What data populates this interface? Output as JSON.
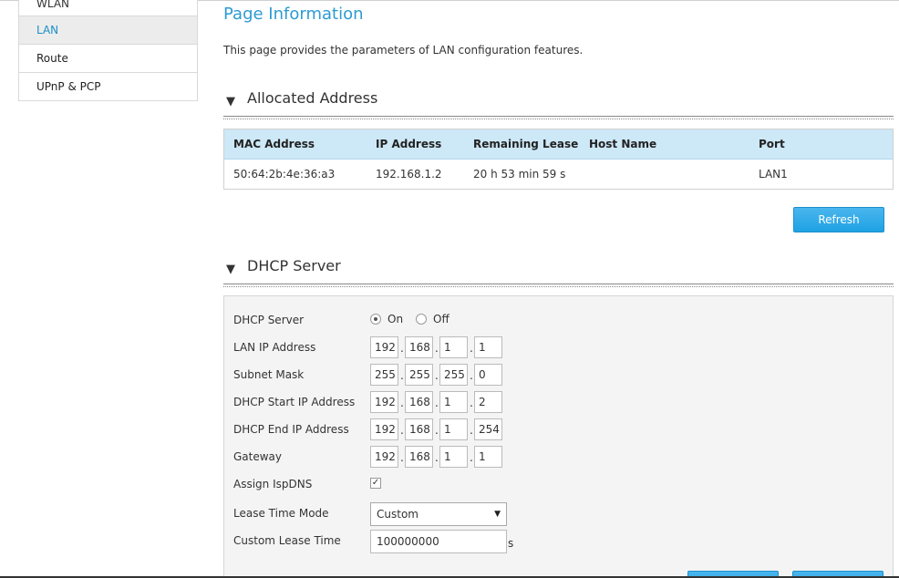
{
  "sidebar": {
    "items": [
      {
        "label": "WLAN"
      },
      {
        "label": "LAN"
      },
      {
        "label": "Route"
      },
      {
        "label": "UPnP & PCP"
      }
    ]
  },
  "page": {
    "title": "Page Information",
    "description": "This page provides the parameters of LAN configuration features."
  },
  "allocated": {
    "title": "Allocated Address",
    "columns": [
      "MAC Address",
      "IP Address",
      "Remaining Lease",
      "Host Name",
      "Port"
    ],
    "rows": [
      [
        "50:64:2b:4e:36:a3",
        "192.168.1.2",
        "20 h 53 min 59 s",
        "",
        "LAN1"
      ]
    ],
    "refresh_label": "Refresh"
  },
  "dhcp": {
    "title": "DHCP Server",
    "server_label": "DHCP Server",
    "on_label": "On",
    "off_label": "Off",
    "server_state": "On",
    "fields": [
      {
        "label": "LAN IP Address",
        "octets": [
          "192",
          "168",
          "1",
          "1"
        ]
      },
      {
        "label": "Subnet Mask",
        "octets": [
          "255",
          "255",
          "255",
          "0"
        ]
      },
      {
        "label": "DHCP Start IP Address",
        "octets": [
          "192",
          "168",
          "1",
          "2"
        ]
      },
      {
        "label": "DHCP End IP Address",
        "octets": [
          "192",
          "168",
          "1",
          "254"
        ]
      },
      {
        "label": "Gateway",
        "octets": [
          "192",
          "168",
          "1",
          "1"
        ]
      }
    ],
    "assign_dns_label": "Assign IspDNS",
    "assign_dns_checked": true,
    "lease_mode_label": "Lease Time Mode",
    "lease_mode_value": "Custom",
    "custom_lease_label": "Custom Lease Time",
    "custom_lease_value": "100000000",
    "custom_lease_unit": "s"
  },
  "colors": {
    "accent": "#2d9bd2",
    "button": "#1ea2e3",
    "table_header": "#cde8f7"
  }
}
